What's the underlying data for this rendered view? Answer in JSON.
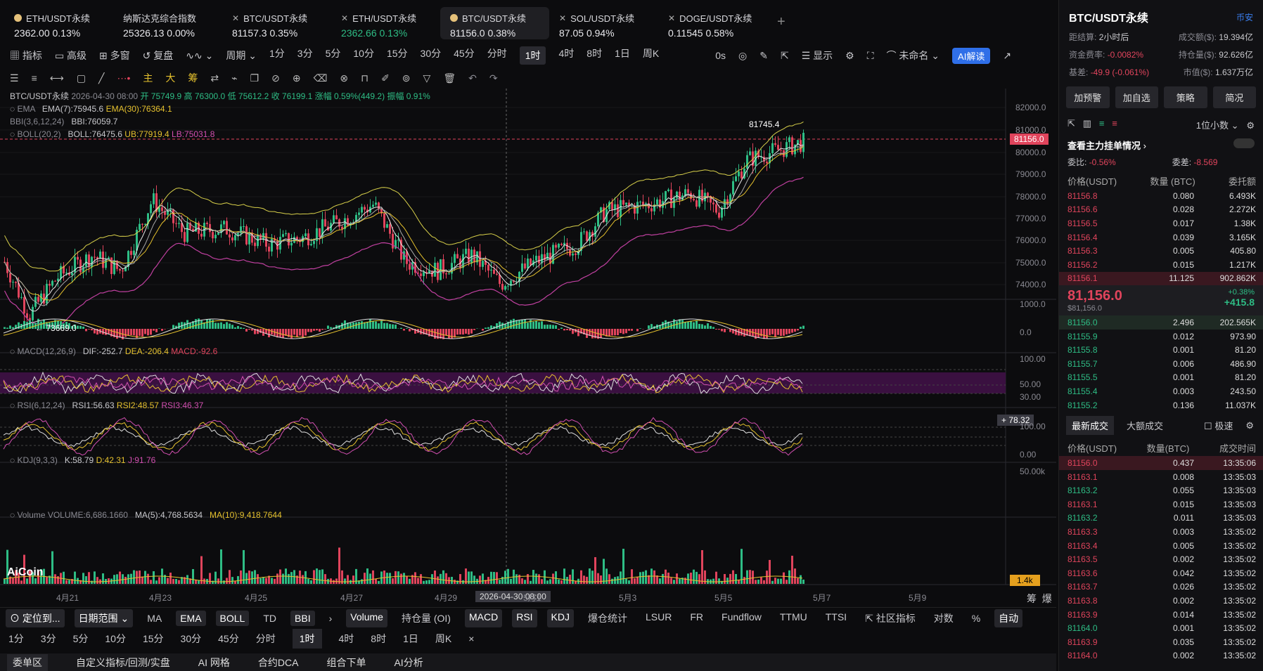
{
  "tabs": [
    {
      "name": "ETH/USDT永续",
      "price": "2362.00",
      "chg": "0.13%",
      "color": "#e5c17a"
    },
    {
      "name": "纳斯达克综合指数",
      "price": "25326.13",
      "chg": "0.00%"
    },
    {
      "name": "BTC/USDT永续",
      "price": "81157.3",
      "chg": "0.35%"
    },
    {
      "name": "ETH/USDT永续",
      "price": "2362.66",
      "chg": "0.13%"
    },
    {
      "name": "BTC/USDT永续",
      "price": "81156.0",
      "chg": "0.38%",
      "color": "#e5c17a"
    },
    {
      "name": "SOL/USDT永续",
      "price": "87.05",
      "chg": "0.94%"
    },
    {
      "name": "DOGE/USDT永续",
      "price": "0.11545",
      "chg": "0.58%"
    }
  ],
  "toolbar": {
    "indicator": "指标",
    "advanced": "高级",
    "multi": "多窗",
    "replay": "复盘",
    "period": "周期",
    "intervals": [
      "1分",
      "3分",
      "5分",
      "10分",
      "15分",
      "30分",
      "45分",
      "分时",
      "1时",
      "4时",
      "8时",
      "1日",
      "周K"
    ],
    "active": "1时",
    "sec": "0s",
    "display": "显示",
    "unnamed": "未命名",
    "ai": "AI解读"
  },
  "drawbar": {
    "main": "主",
    "big": "大",
    "chip": "筹"
  },
  "chart_header": {
    "symbol": "BTC/USDT永续",
    "date": "2026-04-30 08:00",
    "open": "开 75749.9",
    "high": "高 76300.0",
    "low": "低 75612.2",
    "close": "收 76199.1",
    "chg": "涨幅 0.59%(449.2)",
    "amp": "振幅 0.91%",
    "ema": "EMA",
    "ema7": "EMA(7):75945.6",
    "ema30": "EMA(30):76364.1",
    "bbi": "BBI(3,6,12,24)",
    "bbiv": "BBI:76059.7",
    "boll": "BOLL(20,2)",
    "bollv": "BOLL:76475.6",
    "ub": "UB:77919.4",
    "lb": "LB:75031.8",
    "macd": "MACD(12,26,9)",
    "dif": "DIF:-252.7",
    "dea": "DEA:-206.4",
    "macdv": "MACD:-92.6",
    "rsi": "RSI(6,12,24)",
    "rsi1": "RSI1:56.63",
    "rsi2": "RSI2:48.57",
    "rsi3": "RSI3:46.37",
    "kdj": "KDJ(9,3,3)",
    "k": "K:58.79",
    "d": "D:42.31",
    "j": "J:91.76",
    "vol": "Volume",
    "volv": "VOLUME:6,686.1660",
    "ma5": "MA(5):4,768.5634",
    "ma10": "MA(10):9,418.7644",
    "hi": "81745.4",
    "lo": "73669.0",
    "price_tag": "81156.0",
    "rsi_tag": "78.32",
    "vol_tag": "1.4k",
    "logo": "AiCoin",
    "crosshair": "2026-04-30 08:00"
  },
  "yaxis": [
    "82000.0",
    "81000.0",
    "80000.0",
    "79000.0",
    "78000.0",
    "77000.0",
    "76000.0",
    "75000.0",
    "74000.0"
  ],
  "macd_axis": [
    "1000.0",
    "0.0",
    "-1000.0"
  ],
  "rsi_axis": [
    "100.00",
    "50.00",
    "30.00"
  ],
  "kdj_axis": [
    "100.00",
    "0.00"
  ],
  "vol_axis": [
    "50.00k"
  ],
  "xaxis": [
    "4月21",
    "4月23",
    "4月25",
    "4月27",
    "4月29",
    "5月1",
    "5月3",
    "5月5",
    "5月7",
    "5月9"
  ],
  "bottom": {
    "locate": "定位到...",
    "range": "日期范围",
    "ind": [
      "MA",
      "EMA",
      "BOLL",
      "TD",
      "BBI"
    ],
    "ind_on": [
      "EMA",
      "BOLL",
      "BBI"
    ],
    "sub": [
      "Volume",
      "持仓量 (OI)",
      "MACD",
      "RSI",
      "KDJ",
      "爆仓统计",
      "LSUR",
      "FR",
      "Fundflow",
      "TTMU",
      "TTSI"
    ],
    "sub_on": [
      "Volume",
      "MACD",
      "RSI",
      "KDJ"
    ],
    "community": "社区指标",
    "log": "对数",
    "pct": "%",
    "auto": "自动",
    "chou": "筹",
    "bao": "爆",
    "intervals": [
      "1分",
      "3分",
      "5分",
      "10分",
      "15分",
      "30分",
      "45分",
      "分时",
      "1时",
      "4时",
      "8时",
      "1日",
      "周K"
    ],
    "tabs": [
      "委单区",
      "自定义指标/回测/实盘",
      "AI 网格",
      "合约DCA",
      "组合下单",
      "AI分析"
    ]
  },
  "right": {
    "title": "BTC/USDT永续",
    "exchange": "币安",
    "stats": [
      [
        "距结算:",
        "2小时后",
        "成交额($):",
        "19.394亿"
      ],
      [
        "资金费率:",
        "-0.0082%",
        "持仓量($):",
        "92.626亿"
      ],
      [
        "基差:",
        "-49.9 (-0.061%)",
        "市值($):",
        "1.637万亿"
      ]
    ],
    "btns": [
      "加预警",
      "加自选",
      "策略",
      "简况"
    ],
    "decimals": "1位小数",
    "depth": "查看主力挂单情况",
    "ratio": "委比:",
    "ratio_v": "-0.56%",
    "diff": "委差:",
    "diff_v": "-8.569",
    "ob_head": [
      "价格(USDT)",
      "数量 (BTC)",
      "委托额"
    ],
    "asks": [
      [
        "81156.8",
        "0.080",
        "6.493K"
      ],
      [
        "81156.6",
        "0.028",
        "2.272K"
      ],
      [
        "81156.5",
        "0.017",
        "1.38K"
      ],
      [
        "81156.4",
        "0.039",
        "3.165K"
      ],
      [
        "81156.3",
        "0.005",
        "405.80"
      ],
      [
        "81156.2",
        "0.015",
        "1.217K"
      ],
      [
        "81156.1",
        "11.125",
        "902.862K"
      ]
    ],
    "last": "81,156.0",
    "last_usd": "$81,156.0",
    "last_pct": "+0.38%",
    "last_chg": "+415.8",
    "bids": [
      [
        "81156.0",
        "2.496",
        "202.565K"
      ],
      [
        "81155.9",
        "0.012",
        "973.90"
      ],
      [
        "81155.8",
        "0.001",
        "81.20"
      ],
      [
        "81155.7",
        "0.006",
        "486.90"
      ],
      [
        "81155.5",
        "0.001",
        "81.20"
      ],
      [
        "81155.4",
        "0.003",
        "243.50"
      ],
      [
        "81155.2",
        "0.136",
        "11.037K"
      ]
    ],
    "trades_tab": "最新成交",
    "big_tab": "大额成交",
    "fast": "极速",
    "tr_head": [
      "价格(USDT)",
      "数量(BTC)",
      "成交时间"
    ],
    "trades": [
      [
        "81156.0",
        "0.437",
        "13:35:06",
        "r"
      ],
      [
        "81163.1",
        "0.008",
        "13:35:03",
        "r"
      ],
      [
        "81163.2",
        "0.055",
        "13:35:03",
        "g"
      ],
      [
        "81163.1",
        "0.015",
        "13:35:03",
        "r"
      ],
      [
        "81163.2",
        "0.011",
        "13:35:03",
        "g"
      ],
      [
        "81163.3",
        "0.003",
        "13:35:02",
        "r"
      ],
      [
        "81163.4",
        "0.005",
        "13:35:02",
        "r"
      ],
      [
        "81163.5",
        "0.002",
        "13:35:02",
        "r"
      ],
      [
        "81163.6",
        "0.042",
        "13:35:02",
        "r"
      ],
      [
        "81163.7",
        "0.026",
        "13:35:02",
        "r"
      ],
      [
        "81163.8",
        "0.002",
        "13:35:02",
        "r"
      ],
      [
        "81163.9",
        "0.014",
        "13:35:02",
        "r"
      ],
      [
        "81164.0",
        "0.001",
        "13:35:02",
        "g"
      ],
      [
        "81163.9",
        "0.035",
        "13:35:02",
        "r"
      ],
      [
        "81164.0",
        "0.002",
        "13:35:02",
        "r"
      ]
    ]
  }
}
